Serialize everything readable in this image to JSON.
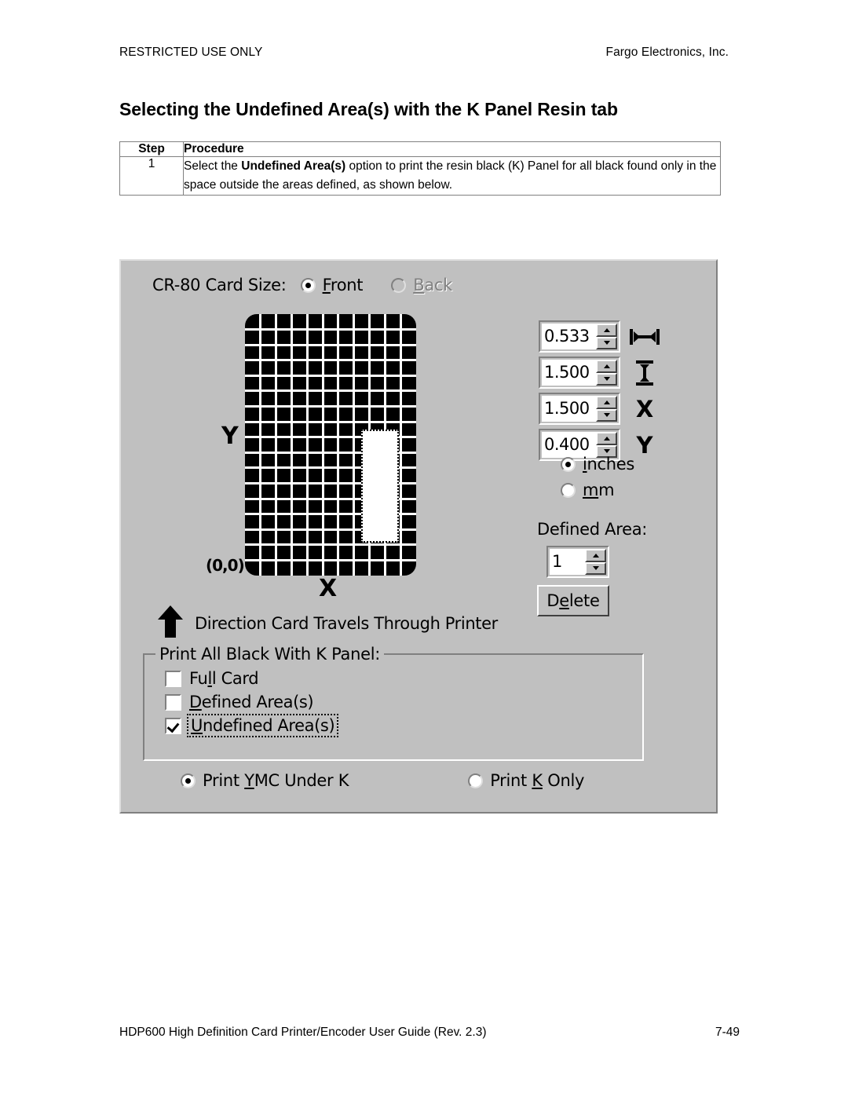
{
  "header": {
    "left": "RESTRICTED USE ONLY",
    "right": "Fargo Electronics, Inc."
  },
  "section": {
    "title": "Selecting the Undefined Area(s) with the K Panel Resin tab"
  },
  "procedure_table": {
    "headers": [
      "Step",
      "Procedure"
    ],
    "rows": [
      {
        "step": "1",
        "text_before": "Select the ",
        "text_bold": "Undefined Area(s)",
        "text_after": " option to print the resin black (K) Panel for all black found only in the space outside the areas defined, as shown below."
      }
    ]
  },
  "dialog": {
    "card_size_label": "CR-80 Card Size:",
    "card_side": {
      "front": {
        "label": "Front",
        "accesskey": "F",
        "selected": true,
        "enabled": true
      },
      "back": {
        "label": "Back",
        "accesskey": "B",
        "selected": false,
        "enabled": false
      }
    },
    "preview": {
      "y_axis_label": "Y",
      "x_axis_label": "X",
      "origin_label": "(0,0)",
      "grid_columns": 11,
      "grid_rows": 17,
      "direction_text": "Direction Card Travels Through Printer",
      "arrow_icon": "arrow-up-icon"
    },
    "dimension_fields": [
      {
        "name": "width",
        "value": "0.533",
        "icon": "width-arrows-icon",
        "icon_glyph": "↦↤"
      },
      {
        "name": "height",
        "value": "1.500",
        "icon": "height-arrows-icon",
        "icon_glyph": "↕"
      },
      {
        "name": "x",
        "value": "1.500",
        "icon": "x-axis-icon",
        "icon_glyph": "X"
      },
      {
        "name": "y",
        "value": "0.400",
        "icon": "y-axis-icon",
        "icon_glyph": "Y"
      }
    ],
    "units": {
      "inches": {
        "label": "inches",
        "accesskey": "i",
        "selected": true
      },
      "mm": {
        "label": "mm",
        "accesskey": "m",
        "selected": false
      }
    },
    "defined_area": {
      "label": "Defined Area:",
      "value": "1",
      "delete_label": "Delete",
      "delete_accesskey": "e"
    },
    "k_panel_group": {
      "title": "Print All Black With K Panel:",
      "options": [
        {
          "label": "Full Card",
          "accesskey": "l",
          "checked": false,
          "focused": false
        },
        {
          "label": "Defined Area(s)",
          "accesskey": "D",
          "checked": false,
          "focused": false
        },
        {
          "label": "Undefined Area(s)",
          "accesskey": "U",
          "checked": true,
          "focused": true
        }
      ]
    },
    "print_mode": {
      "ymc_under_k": {
        "label": "Print YMC Under K",
        "accesskey": "Y",
        "selected": true
      },
      "k_only": {
        "label": "Print K Only",
        "accesskey": "K",
        "selected": false
      }
    }
  },
  "footer": {
    "left": "HDP600 High Definition Card Printer/Encoder User Guide (Rev. 2.3)",
    "right": "7-49"
  },
  "colors": {
    "dialog_face": "#c0c0c0",
    "card_black": "#000000",
    "grid_line": "#ffffff",
    "table_border": "#808080"
  }
}
